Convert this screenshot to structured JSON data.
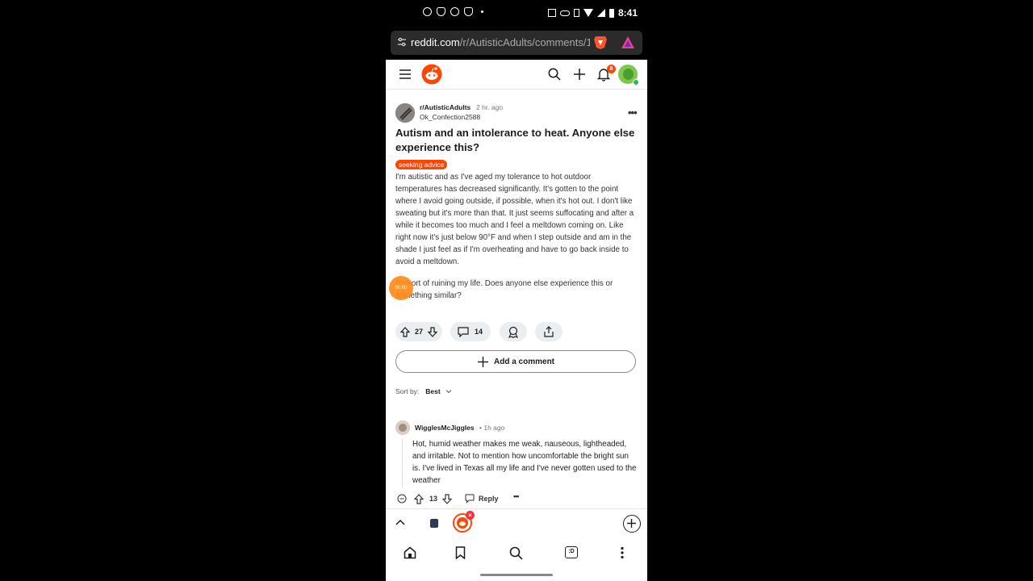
{
  "status_bar": {
    "time": "8:41",
    "battery": "100"
  },
  "browser": {
    "url_domain": "reddit.com",
    "url_path": "/r/AutisticAdults/comments/1"
  },
  "header": {
    "notification_count": "8"
  },
  "post": {
    "subreddit": "r/AutisticAdults",
    "time_ago": "2 hr. ago",
    "author": "Ok_Confection2588",
    "title": "Autism and an intolerance to heat. Anyone else experience this?",
    "flair": "seeking advice",
    "body_p1": "I'm autistic and as I've aged my tolerance to hot outdoor temperatures has decreased significantly. It's gotten to the point where I avoid going outside, if possible, when it's hot out. I don't like sweating but it's more than that. It just seems suffocating and after a while it becomes too much and I feel a meltdown coming on. Like right now it's just below 90°F and when I step outside and am in the shade I just feel as if I'm overheating and have to go back inside to avoid a meltdown.",
    "body_p2": "It's sort of ruining my life. Does anyone else experience this or something similar?",
    "votes": "27",
    "comments": "14"
  },
  "add_comment_label": "Add a comment",
  "sort": {
    "label": "Sort by:",
    "value": "Best"
  },
  "comment": {
    "author": "WigglesMcJiggles",
    "time_ago": "• 1h ago",
    "body": "Hot, humid weather makes me weak, nauseous, lightheaded, and irritable. Not to mention how uncomfortable the bright sun is. I've lived in Texas all my life and I've never gotten used to the weather",
    "votes": "13",
    "reply_label": "Reply"
  },
  "recorder_badge": "00:00",
  "tab_badge": ":D",
  "colors": {
    "accent": "#ff4500",
    "status_bg": "#000000",
    "url_bg": "#2b2b2b"
  }
}
